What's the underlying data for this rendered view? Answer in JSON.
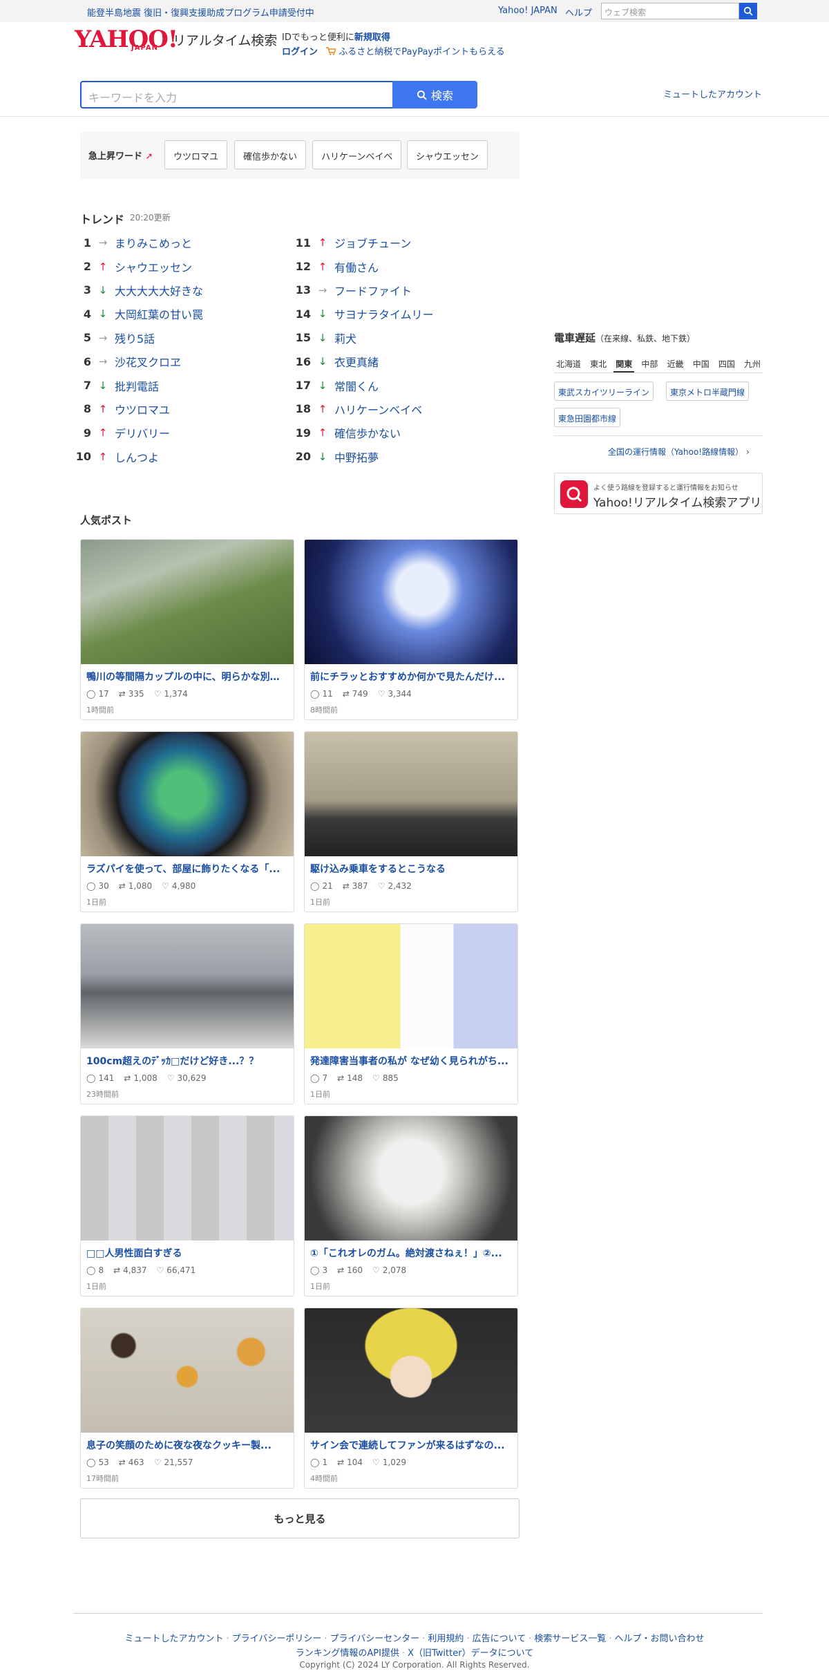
{
  "topbar": {
    "notice": "能登半島地震 復旧・復興支援助成プログラム申請受付中",
    "yahoo_japan": "Yahoo! JAPAN",
    "help": "ヘルプ",
    "web_search_placeholder": "ウェブ検索"
  },
  "header": {
    "logo": "YAHOO!",
    "logo_sub": "JAPAN",
    "service": "リアルタイム検索",
    "id_text": "IDでもっと便利に",
    "signup": "新規取得",
    "login": "ログイン",
    "furusato": "ふるさと納税でPayPayポイントもらえる"
  },
  "search": {
    "placeholder": "キーワードを入力",
    "button": "検索",
    "muted_accounts": "ミュートしたアカウント"
  },
  "rising": {
    "label": "急上昇ワード",
    "words": [
      "ウツロマユ",
      "確信歩かない",
      "ハリケーンベイベ",
      "シャウエッセン"
    ]
  },
  "trend": {
    "title": "トレンド",
    "updated": "20:20更新",
    "items": [
      {
        "rank": "1",
        "dir": "same",
        "word": "まりみこめっと"
      },
      {
        "rank": "2",
        "dir": "up",
        "word": "シャウエッセン"
      },
      {
        "rank": "3",
        "dir": "down",
        "word": "大大大大大好きな"
      },
      {
        "rank": "4",
        "dir": "down",
        "word": "大岡紅葉の甘い罠"
      },
      {
        "rank": "5",
        "dir": "same",
        "word": "残り5話"
      },
      {
        "rank": "6",
        "dir": "same",
        "word": "沙花叉クロヱ"
      },
      {
        "rank": "7",
        "dir": "down",
        "word": "批判電話"
      },
      {
        "rank": "8",
        "dir": "up",
        "word": "ウツロマユ"
      },
      {
        "rank": "9",
        "dir": "up",
        "word": "デリバリー"
      },
      {
        "rank": "10",
        "dir": "up",
        "word": "しんつよ"
      },
      {
        "rank": "11",
        "dir": "up",
        "word": "ジョブチューン"
      },
      {
        "rank": "12",
        "dir": "up",
        "word": "有働さん"
      },
      {
        "rank": "13",
        "dir": "same",
        "word": "フードファイト"
      },
      {
        "rank": "14",
        "dir": "down",
        "word": "サヨナラタイムリー"
      },
      {
        "rank": "15",
        "dir": "down",
        "word": "莉犬"
      },
      {
        "rank": "16",
        "dir": "down",
        "word": "衣更真緒"
      },
      {
        "rank": "17",
        "dir": "down",
        "word": "常闇くん"
      },
      {
        "rank": "18",
        "dir": "up",
        "word": "ハリケーンベイベ"
      },
      {
        "rank": "19",
        "dir": "up",
        "word": "確信歩かない"
      },
      {
        "rank": "20",
        "dir": "down",
        "word": "中野拓夢"
      }
    ]
  },
  "train": {
    "title": "電車遅延",
    "subtitle": "（在来線、私鉄、地下鉄）",
    "regions": [
      "北海道",
      "東北",
      "関東",
      "中部",
      "近畿",
      "中国",
      "四国",
      "九州"
    ],
    "active_region": "関東",
    "lines": [
      "東武スカイツリーライン",
      "東京メトロ半蔵門線",
      "東急田園都市線"
    ],
    "all_link": "全国の運行情報（Yahoo!路線情報）",
    "app_text1": "よく使う路線を登録すると運行情報をお知らせ",
    "app_text2": "Yahoo!リアルタイム検索アプリ"
  },
  "popular": {
    "title": "人気ポスト",
    "posts": [
      {
        "title": "鴨川の等間隔カップルの中に、明らかな別の...",
        "replies": "17",
        "reposts": "335",
        "likes": "1,374",
        "age": "1時間前"
      },
      {
        "title": "前にチラッとおすすめか何かで見たんだけ...",
        "replies": "11",
        "reposts": "749",
        "likes": "3,344",
        "age": "8時間前"
      },
      {
        "title": "ラズパイを使って、部屋に飾りたくなる「...",
        "replies": "30",
        "reposts": "1,080",
        "likes": "4,980",
        "age": "1日前"
      },
      {
        "title": "駆け込み乗車をするとこうなる",
        "replies": "21",
        "reposts": "387",
        "likes": "2,432",
        "age": "1日前"
      },
      {
        "title": "100cm超えのﾃﾞｯｶ□だけど好き...？？",
        "replies": "141",
        "reposts": "1,008",
        "likes": "30,629",
        "age": "23時間前"
      },
      {
        "title": "発達障害当事者の私が なぜ幼く見られがち...",
        "replies": "7",
        "reposts": "148",
        "likes": "885",
        "age": "1日前"
      },
      {
        "title": "□□人男性面白すぎる",
        "replies": "8",
        "reposts": "4,837",
        "likes": "66,471",
        "age": "1日前"
      },
      {
        "title": "①「これオレのガム。絶対渡さねぇ！」②...",
        "replies": "3",
        "reposts": "160",
        "likes": "2,078",
        "age": "1日前"
      },
      {
        "title": "息子の笑顔のために夜な夜なクッキー製...",
        "replies": "53",
        "reposts": "463",
        "likes": "21,557",
        "age": "17時間前"
      },
      {
        "title": "サイン会で連続してファンが来るはずなの...",
        "replies": "1",
        "reposts": "104",
        "likes": "1,029",
        "age": "4時間前"
      }
    ],
    "more": "もっと見る"
  },
  "footer": {
    "links": [
      "ミュートしたアカウント",
      "プライバシーポリシー",
      "プライバシーセンター",
      "利用規約",
      "広告について",
      "検索サービス一覧",
      "ヘルプ・お問い合わせ"
    ],
    "links2": [
      "ランキング情報のAPI提供",
      "X（旧Twitter）データについて"
    ],
    "copyright": "Copyright (C) 2024 LY Corporation. All Rights Reserved."
  },
  "colors": {
    "brand_red": "#e0173b",
    "link_blue": "#1a4fa3",
    "search_blue": "#3d76f0",
    "up": "#e0173b",
    "down": "#1f8a3a"
  }
}
